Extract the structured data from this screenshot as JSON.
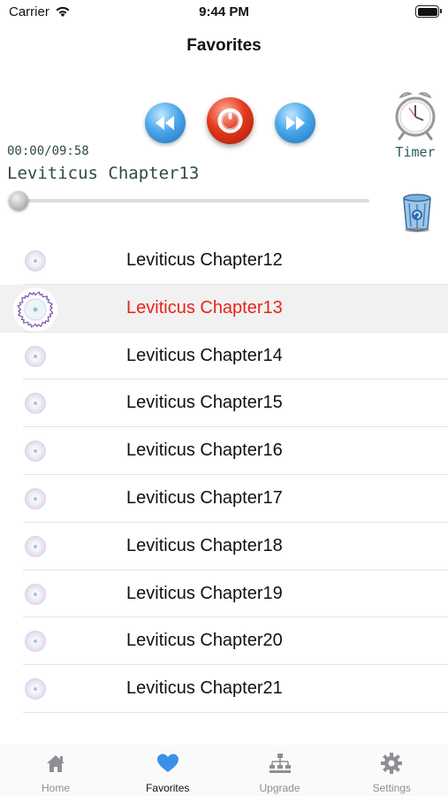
{
  "status_bar": {
    "carrier": "Carrier",
    "time": "9:44 PM"
  },
  "nav": {
    "title": "Favorites"
  },
  "player": {
    "time_readout": "00:00/09:58",
    "now_playing": "Leviticus Chapter13",
    "progress": 0.02,
    "timer_label": "Timer",
    "controls": {
      "rewind_icon": "rewind-icon",
      "power_icon": "power-icon",
      "forward_icon": "fast-forward-icon",
      "timer_icon": "alarm-clock-icon",
      "trash_icon": "trash-icon"
    }
  },
  "list": {
    "items": [
      {
        "label": "Leviticus Chapter12"
      },
      {
        "label": "Leviticus Chapter13"
      },
      {
        "label": "Leviticus Chapter14"
      },
      {
        "label": "Leviticus Chapter15"
      },
      {
        "label": "Leviticus Chapter16"
      },
      {
        "label": "Leviticus Chapter17"
      },
      {
        "label": "Leviticus Chapter18"
      },
      {
        "label": "Leviticus Chapter19"
      },
      {
        "label": "Leviticus Chapter20"
      },
      {
        "label": "Leviticus Chapter21"
      }
    ],
    "selected_index": 1,
    "selected_color": "#e8231b"
  },
  "tab_bar": {
    "tabs": [
      {
        "label": "Home",
        "icon": "house-icon"
      },
      {
        "label": "Favorites",
        "icon": "heart-icon"
      },
      {
        "label": "Upgrade",
        "icon": "hierarchy-icon"
      },
      {
        "label": "Settings",
        "icon": "gear-icon"
      }
    ],
    "active_index": 1,
    "active_color": "#3b8fe8",
    "inactive_color": "#8e8e93"
  }
}
